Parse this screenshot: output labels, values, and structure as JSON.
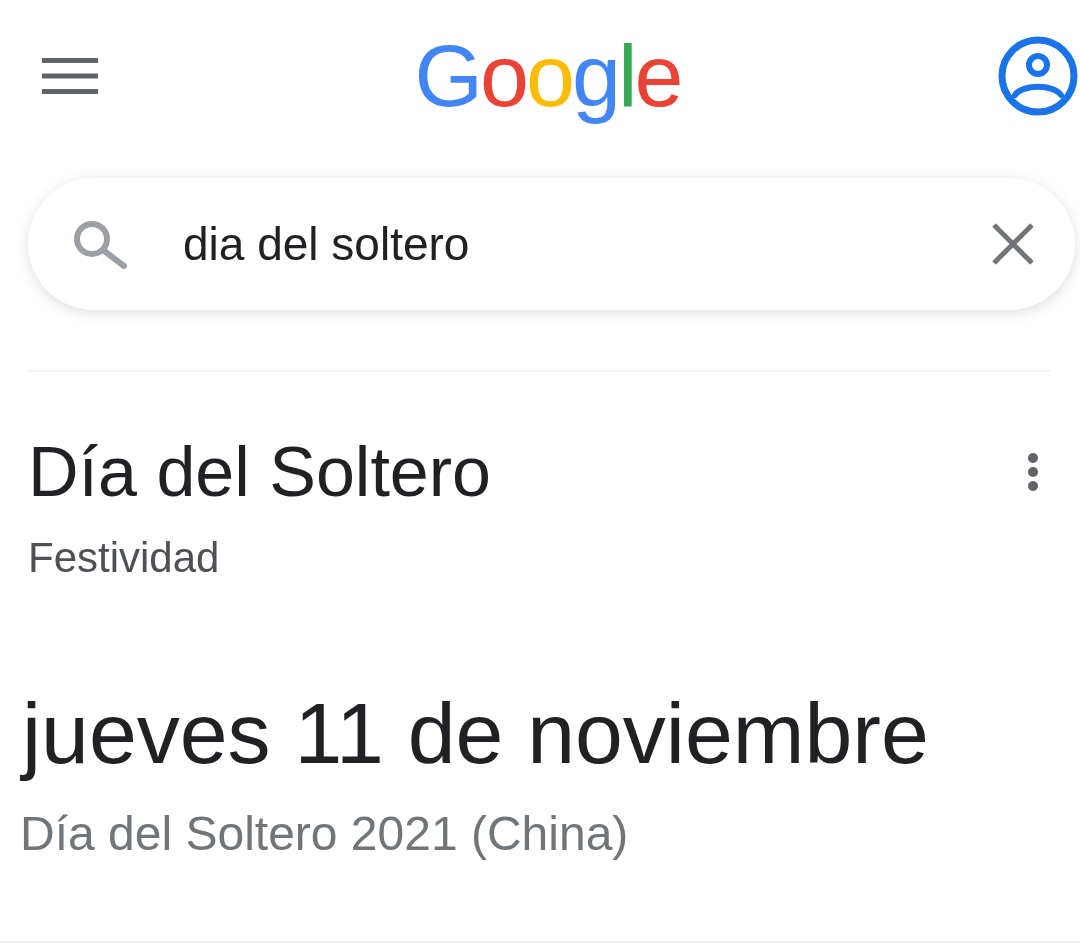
{
  "header": {
    "logo": "Google"
  },
  "search": {
    "value": "dia del soltero"
  },
  "result": {
    "title": "Día del Soltero",
    "subtitle": "Festividad",
    "date": "jueves 11 de noviembre",
    "caption": "Día del Soltero 2021 (China)"
  }
}
